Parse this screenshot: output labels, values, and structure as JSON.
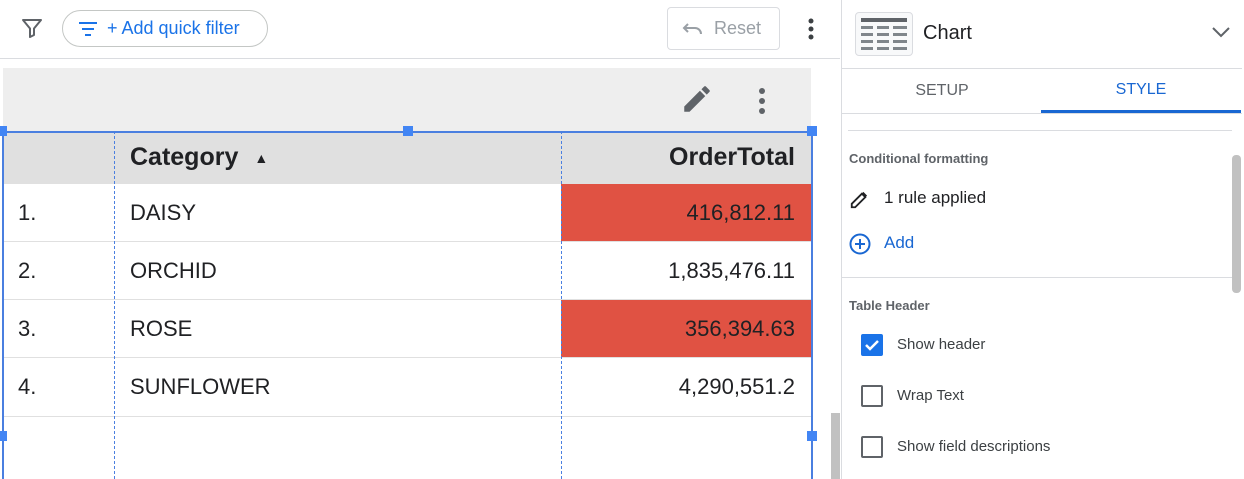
{
  "toolbar": {
    "quick_filter_label": "+ Add quick filter",
    "reset_label": "Reset"
  },
  "table": {
    "headers": {
      "num": "",
      "category": "Category",
      "total": "OrderTotal",
      "sort_indicator": "▲"
    },
    "rows": [
      {
        "num": "1.",
        "category": "DAISY",
        "total": "416,812.11",
        "highlight": true
      },
      {
        "num": "2.",
        "category": "ORCHID",
        "total": "1,835,476.11",
        "highlight": false
      },
      {
        "num": "3.",
        "category": "ROSE",
        "total": "356,394.63",
        "highlight": true
      },
      {
        "num": "4.",
        "category": "SUNFLOWER",
        "total": "4,290,551.2",
        "highlight": false
      }
    ],
    "highlight_color": "#e05243"
  },
  "panel": {
    "chart_type_label": "Chart",
    "tabs": [
      {
        "label": "SETUP",
        "active": false
      },
      {
        "label": "STYLE",
        "active": true
      }
    ],
    "conditional_formatting": {
      "title": "Conditional formatting",
      "rule_text": "1 rule applied",
      "add_label": "Add"
    },
    "table_header": {
      "title": "Table Header",
      "options": [
        {
          "label": "Show header",
          "checked": true
        },
        {
          "label": "Wrap Text",
          "checked": false
        },
        {
          "label": "Show field descriptions",
          "checked": false
        }
      ]
    }
  },
  "colors": {
    "accent": "#1a73e8",
    "selection": "#4285f4"
  }
}
